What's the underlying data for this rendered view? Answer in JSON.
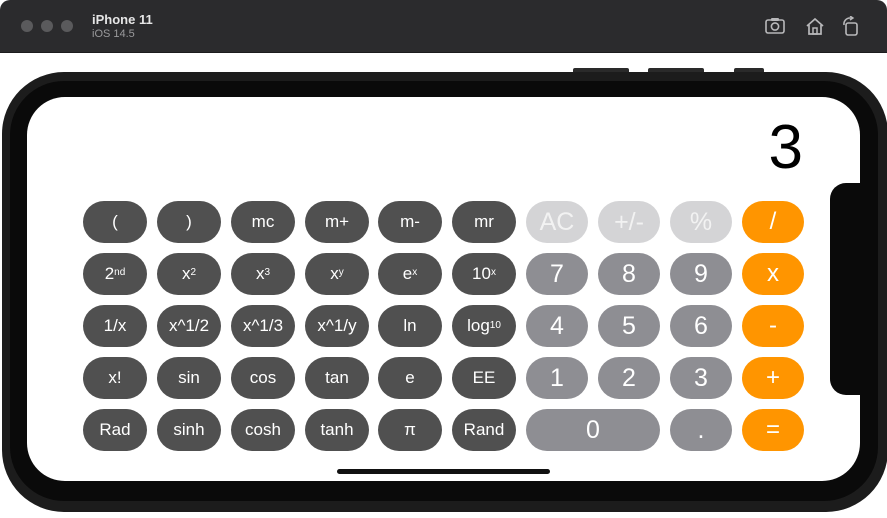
{
  "simulator": {
    "device_name": "iPhone 11",
    "os_version": "iOS 14.5",
    "icons": [
      "screenshot-icon",
      "home-icon",
      "rotate-icon"
    ]
  },
  "calculator": {
    "display": "3",
    "row1": [
      "(",
      ")",
      "mc",
      "m+",
      "m-",
      "mr",
      "AC",
      "+/-",
      "%",
      "/"
    ],
    "row2": {
      "second": "2",
      "second_sup": "nd",
      "x2_base": "x",
      "x2_sup": "2",
      "x3_base": "x",
      "x3_sup": "3",
      "xy_base": "x",
      "xy_sup": "y",
      "ex_base": "e",
      "ex_sup": "x",
      "tenx_base": "10",
      "tenx_sup": "x",
      "seven": "7",
      "eight": "8",
      "nine": "9",
      "multiply": "x"
    },
    "row3": {
      "recip": "1/x",
      "sqrt": "x^1/2",
      "cbrt": "x^1/3",
      "yroot": "x^1/y",
      "ln": "ln",
      "log_base": "log",
      "log_sub": "10",
      "four": "4",
      "five": "5",
      "six": "6",
      "minus": "-"
    },
    "row4": [
      "x!",
      "sin",
      "cos",
      "tan",
      "e",
      "EE",
      "1",
      "2",
      "3",
      "+"
    ],
    "row5": [
      "Rad",
      "sinh",
      "cosh",
      "tanh",
      "π",
      "Rand",
      "0",
      ".",
      "="
    ]
  },
  "colors": {
    "scientific_key": "#505050",
    "number_key": "#8e8e93",
    "disabled_key": "#d4d4d6",
    "operator_key": "#ff9500"
  }
}
